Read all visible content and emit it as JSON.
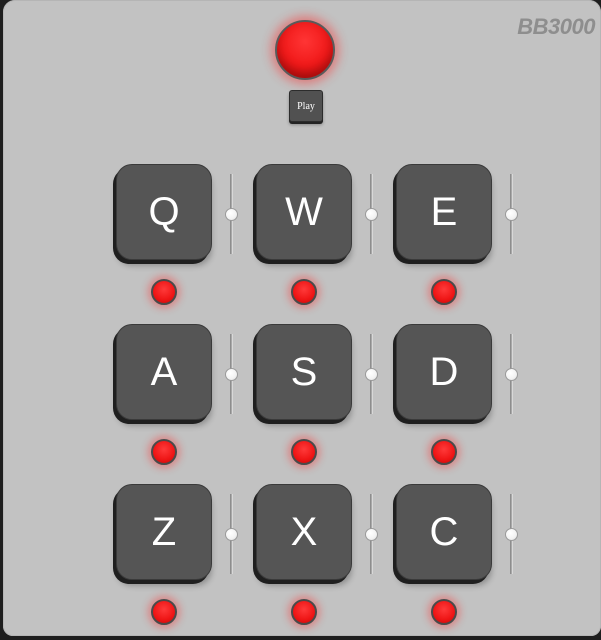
{
  "brand": "BB3000",
  "controls": {
    "play_label": "Play",
    "main_light": "red-indicator-light"
  },
  "pads": [
    {
      "key": "Q",
      "volume": 0.5,
      "led": "red"
    },
    {
      "key": "W",
      "volume": 0.5,
      "led": "red"
    },
    {
      "key": "E",
      "volume": 0.5,
      "led": "red"
    },
    {
      "key": "A",
      "volume": 0.5,
      "led": "red"
    },
    {
      "key": "S",
      "volume": 0.5,
      "led": "red"
    },
    {
      "key": "D",
      "volume": 0.5,
      "led": "red"
    },
    {
      "key": "Z",
      "volume": 0.5,
      "led": "red"
    },
    {
      "key": "X",
      "volume": 0.5,
      "led": "red"
    },
    {
      "key": "C",
      "volume": 0.5,
      "led": "red"
    }
  ],
  "colors": {
    "body": "#c2c2c2",
    "pad": "#555555",
    "led": "#ee1515",
    "brand": "#8e8e8e"
  }
}
